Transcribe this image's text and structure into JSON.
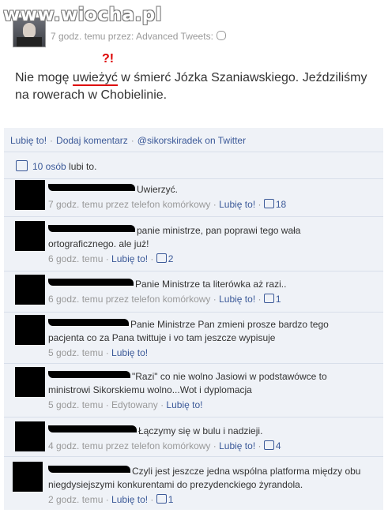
{
  "watermark": "www.wiocha.pl",
  "post": {
    "meta": "7 godz. temu przez: Advanced Tweets:",
    "text_before": "Nie mogę ",
    "text_highlight": "uwieżyć",
    "text_after": " w śmierć Józka Szaniawskiego. Jeździliśmy na rowerach w Chobielinie.",
    "annotation": "?!"
  },
  "actions": {
    "like": "Lubię to!",
    "comment": "Dodaj komentarz",
    "twitter": "@sikorskiradek on Twitter"
  },
  "likes": {
    "link": "10 osób",
    "text": "lubi to."
  },
  "comments": [
    {
      "text": "Uwierzyć.",
      "time": "7 godz. temu przez telefon komórkowy",
      "like": "Lubię to!",
      "count": "18"
    },
    {
      "text": "panie ministrze, pan poprawi tego wała ortograficznego. ale już!",
      "time": "6 godz. temu",
      "like": "Lubię to!",
      "count": "2"
    },
    {
      "text": "Panie Ministrze ta literówka aż razi..",
      "time": "6 godz. temu przez telefon komórkowy",
      "like": "Lubię to!",
      "count": "1"
    },
    {
      "text": "Panie Ministrze Pan zmieni prosze bardzo tego pacjenta co za Pana twittuje i vo tam jeszcze wypisuje",
      "time": "5 godz. temu",
      "like": "Lubię to!",
      "count": ""
    },
    {
      "text": "\"Razi\" co nie wolno Jasiowi w podstawówce to ministrowi Sikorskiemu wolno...Wot i dyplomacja",
      "time": "5 godz. temu",
      "edited": "Edytowany",
      "like": "Lubię to!",
      "count": ""
    },
    {
      "text": "Łączymy się w bulu i nadzieji.",
      "time": "4 godz. temu przez telefon komórkowy",
      "like": "Lubię to!",
      "count": "4"
    },
    {
      "text": "Czyli jest jeszcze jedna wspólna platforma między obu niegdysiejszymi konkurentami do prezydenckiego żyrandola.",
      "time": "2 godz. temu",
      "like": "Lubię to!",
      "count": "1"
    }
  ]
}
